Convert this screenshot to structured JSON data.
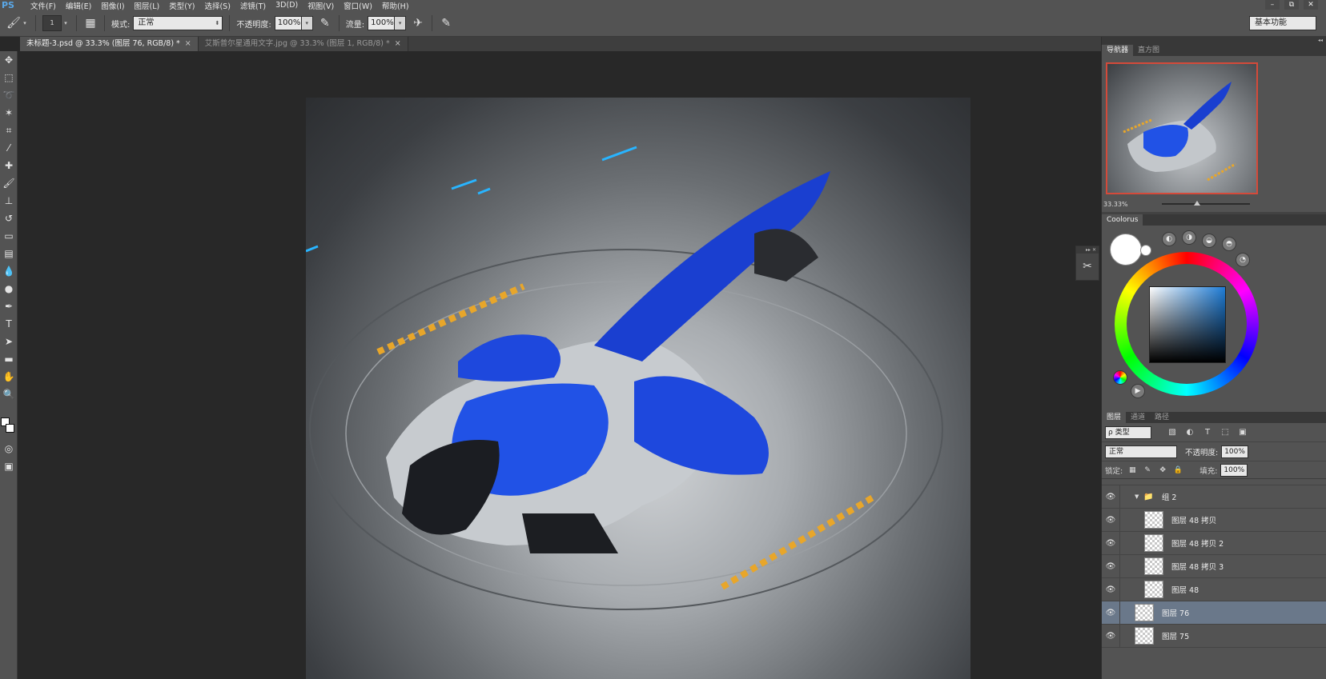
{
  "app": {
    "logo": "PS",
    "menu": [
      "文件(F)",
      "编辑(E)",
      "图像(I)",
      "图层(L)",
      "类型(Y)",
      "选择(S)",
      "滤镜(T)",
      "3D(D)",
      "视图(V)",
      "窗口(W)",
      "帮助(H)"
    ],
    "window_controls": [
      "–",
      "⧉",
      "✕"
    ]
  },
  "options": {
    "brush_size": "1",
    "mode_label": "模式:",
    "mode_value": "正常",
    "opacity_label": "不透明度:",
    "opacity_value": "100%",
    "flow_label": "流量:",
    "flow_value": "100%",
    "workspace": "基本功能"
  },
  "tabs": [
    {
      "label": "未标题-3.psd @ 33.3% (图层 76, RGB/8) *",
      "close": "×"
    },
    {
      "label": "艾斯普尔星通用文字.jpg @ 33.3% (图层 1, RGB/8) *",
      "close": "×"
    }
  ],
  "navigator": {
    "tabs": [
      "导航器",
      "直方图"
    ],
    "zoom": "33.33%"
  },
  "coolorus": {
    "tab": "Coolorus",
    "foreground": "#ffffff",
    "background": "#ffffff",
    "hue_color": "#1e7cd6"
  },
  "layers": {
    "tabs": [
      "图层",
      "通道",
      "路径"
    ],
    "kind_label": "ρ 类型",
    "blend_mode": "正常",
    "opacity_label": "不透明度:",
    "opacity_value": "100%",
    "lock_label": "锁定:",
    "fill_label": "填充:",
    "fill_value": "100%",
    "group_name": "组 2",
    "rows": [
      {
        "name": "图层 48 拷贝",
        "selected": false
      },
      {
        "name": "图层 48 拷贝 2",
        "selected": false
      },
      {
        "name": "图层 48 拷贝 3",
        "selected": false
      },
      {
        "name": "图层 48",
        "selected": false
      },
      {
        "name": "图层 76",
        "selected": true
      },
      {
        "name": "图层 75",
        "selected": false
      }
    ]
  }
}
